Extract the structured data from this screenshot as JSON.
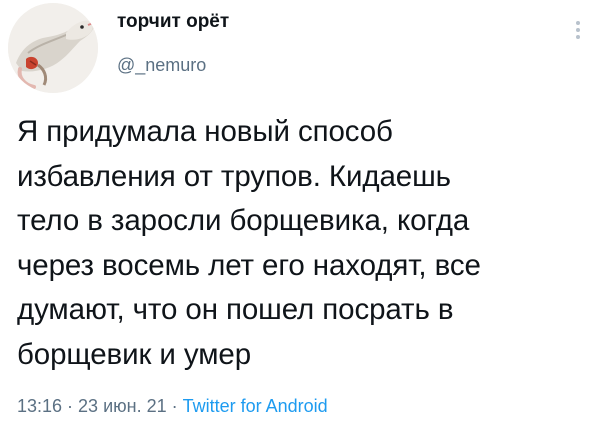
{
  "author": {
    "display_name": "торчит орёт",
    "handle": "@_nemuro",
    "avatar_icon": "opossum-avatar-icon"
  },
  "menu_icon": "more-vertical-icon",
  "tweet": {
    "lines": [
      "Я придумала новый способ",
      "избавления от трупов. Кидаешь",
      "тело в заросли борщевика, когда",
      "через восемь лет его находят, все",
      "думают, что он пошел посрать в",
      "борщевик и умер"
    ]
  },
  "meta": {
    "time": "13:16",
    "date": "23 июн. 21",
    "separator": "·",
    "source": "Twitter for Android"
  },
  "colors": {
    "text": "#0f1419",
    "secondary": "#5b7083",
    "link": "#1d9bf0"
  }
}
